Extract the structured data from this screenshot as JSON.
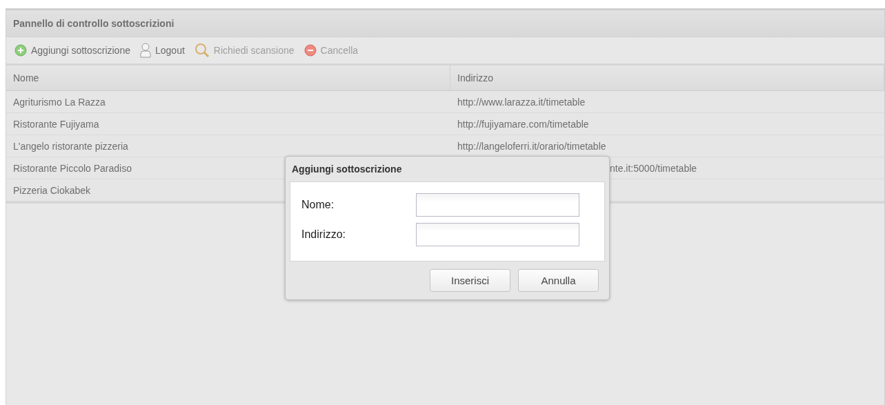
{
  "panel": {
    "title": "Pannello di controllo sottoscrizioni"
  },
  "toolbar": [
    {
      "kind": "add",
      "label": "Aggiungi sottoscrizione",
      "disabled": false
    },
    {
      "kind": "user",
      "label": "Logout",
      "disabled": false
    },
    {
      "kind": "search",
      "label": "Richiedi scansione",
      "disabled": true
    },
    {
      "kind": "remove",
      "label": "Cancella",
      "disabled": true
    }
  ],
  "table": {
    "columns": [
      "Nome",
      "Indirizzo"
    ],
    "rows": [
      {
        "name": "Agriturismo La Razza",
        "address": "http://www.larazza.it/timetable"
      },
      {
        "name": "Ristorante Fujiyama",
        "address": "http://fujiyamare.com/timetable"
      },
      {
        "name": "L'angelo ristorante pizzeria",
        "address": "http://langeloferri.it/orario/timetable"
      },
      {
        "name": "Ristorante Piccolo Paradiso",
        "address": "nte.it:5000/timetable",
        "clipped": true
      },
      {
        "name": "Pizzeria Ciokabek"
      }
    ]
  },
  "dialog": {
    "title": "Aggiungi sottoscrizione",
    "fields": [
      {
        "label": "Nome:"
      },
      {
        "label": "Indirizzo:"
      }
    ],
    "buttons": [
      "Inserisci",
      "Annulla"
    ]
  }
}
